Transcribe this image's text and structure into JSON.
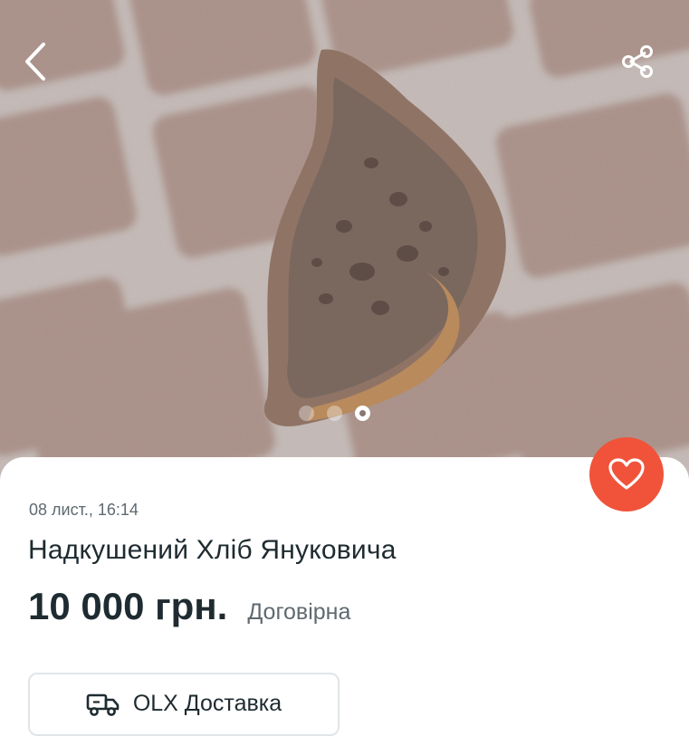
{
  "listing": {
    "date": "08 лист., 16:14",
    "title": "Надкушений Хліб Януковича",
    "price": "10 000 грн.",
    "negotiable": "Договірна"
  },
  "gallery": {
    "photo_count": 3,
    "active_index": 3
  },
  "delivery": {
    "label": "OLX Доставка"
  },
  "colors": {
    "favorite_button": "#f0533a",
    "text_primary": "#1e2b30",
    "text_secondary": "#5f6a70"
  },
  "icons": {
    "back": "chevron-left-icon",
    "share": "share-icon",
    "favorite": "heart-icon",
    "delivery": "truck-icon"
  }
}
